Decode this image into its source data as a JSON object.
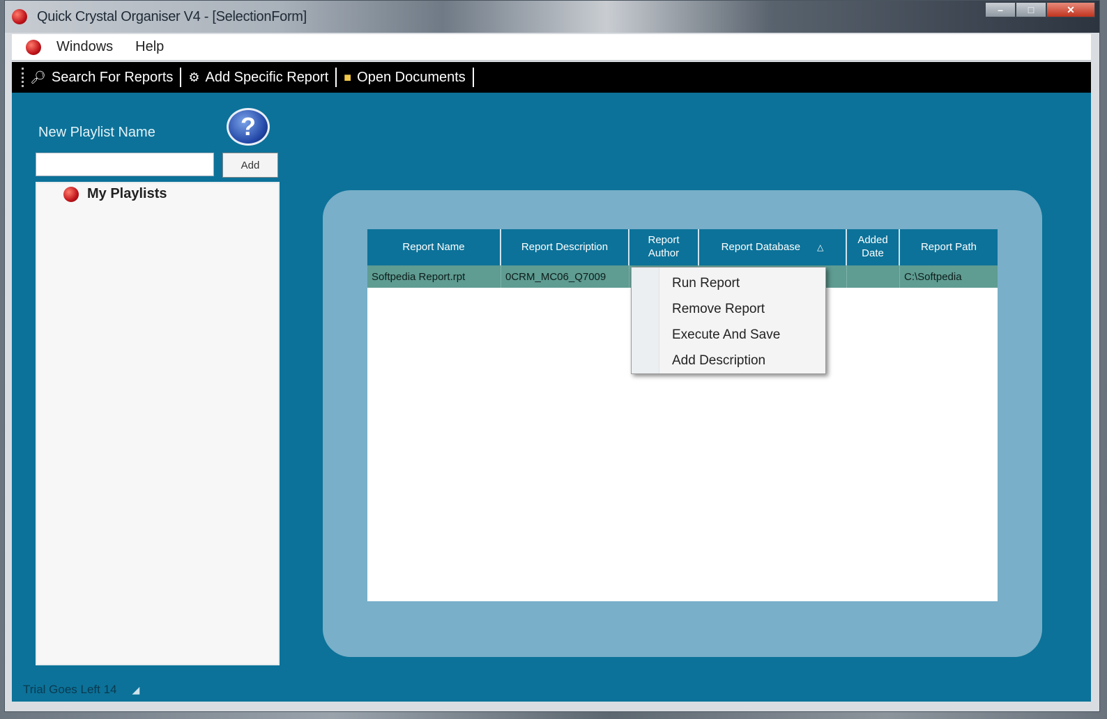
{
  "window": {
    "title": "Quick Crystal Organiser V4 - [SelectionForm]"
  },
  "menubar": {
    "items": [
      "Windows",
      "Help"
    ]
  },
  "toolbar": {
    "search_label": "Search For Reports",
    "add_specific_label": "Add Specific Report",
    "open_documents_label": "Open Documents"
  },
  "sidebar": {
    "new_playlist_label": "New Playlist Name",
    "name_input_value": "",
    "add_button_label": "Add",
    "tree_root_label": "My Playlists"
  },
  "grid": {
    "columns": [
      "Report Name",
      "Report Description",
      "Report Author",
      "Report Database",
      "Added Date",
      "Report Path"
    ],
    "rows": [
      [
        "Softpedia Report.rpt",
        "0CRM_MC06_Q7009",
        "",
        "",
        "",
        "C:\\Softpedia"
      ]
    ]
  },
  "context_menu": {
    "items": [
      "Run Report",
      "Remove Report",
      "Execute And Save",
      "Add Description"
    ]
  },
  "statusbar": {
    "text": "Trial Goes Left 14"
  },
  "colors": {
    "client_background": "#0c7299",
    "frame": "#79afc9",
    "selected_row": "#5f9c92",
    "toolbar": "#000000"
  }
}
